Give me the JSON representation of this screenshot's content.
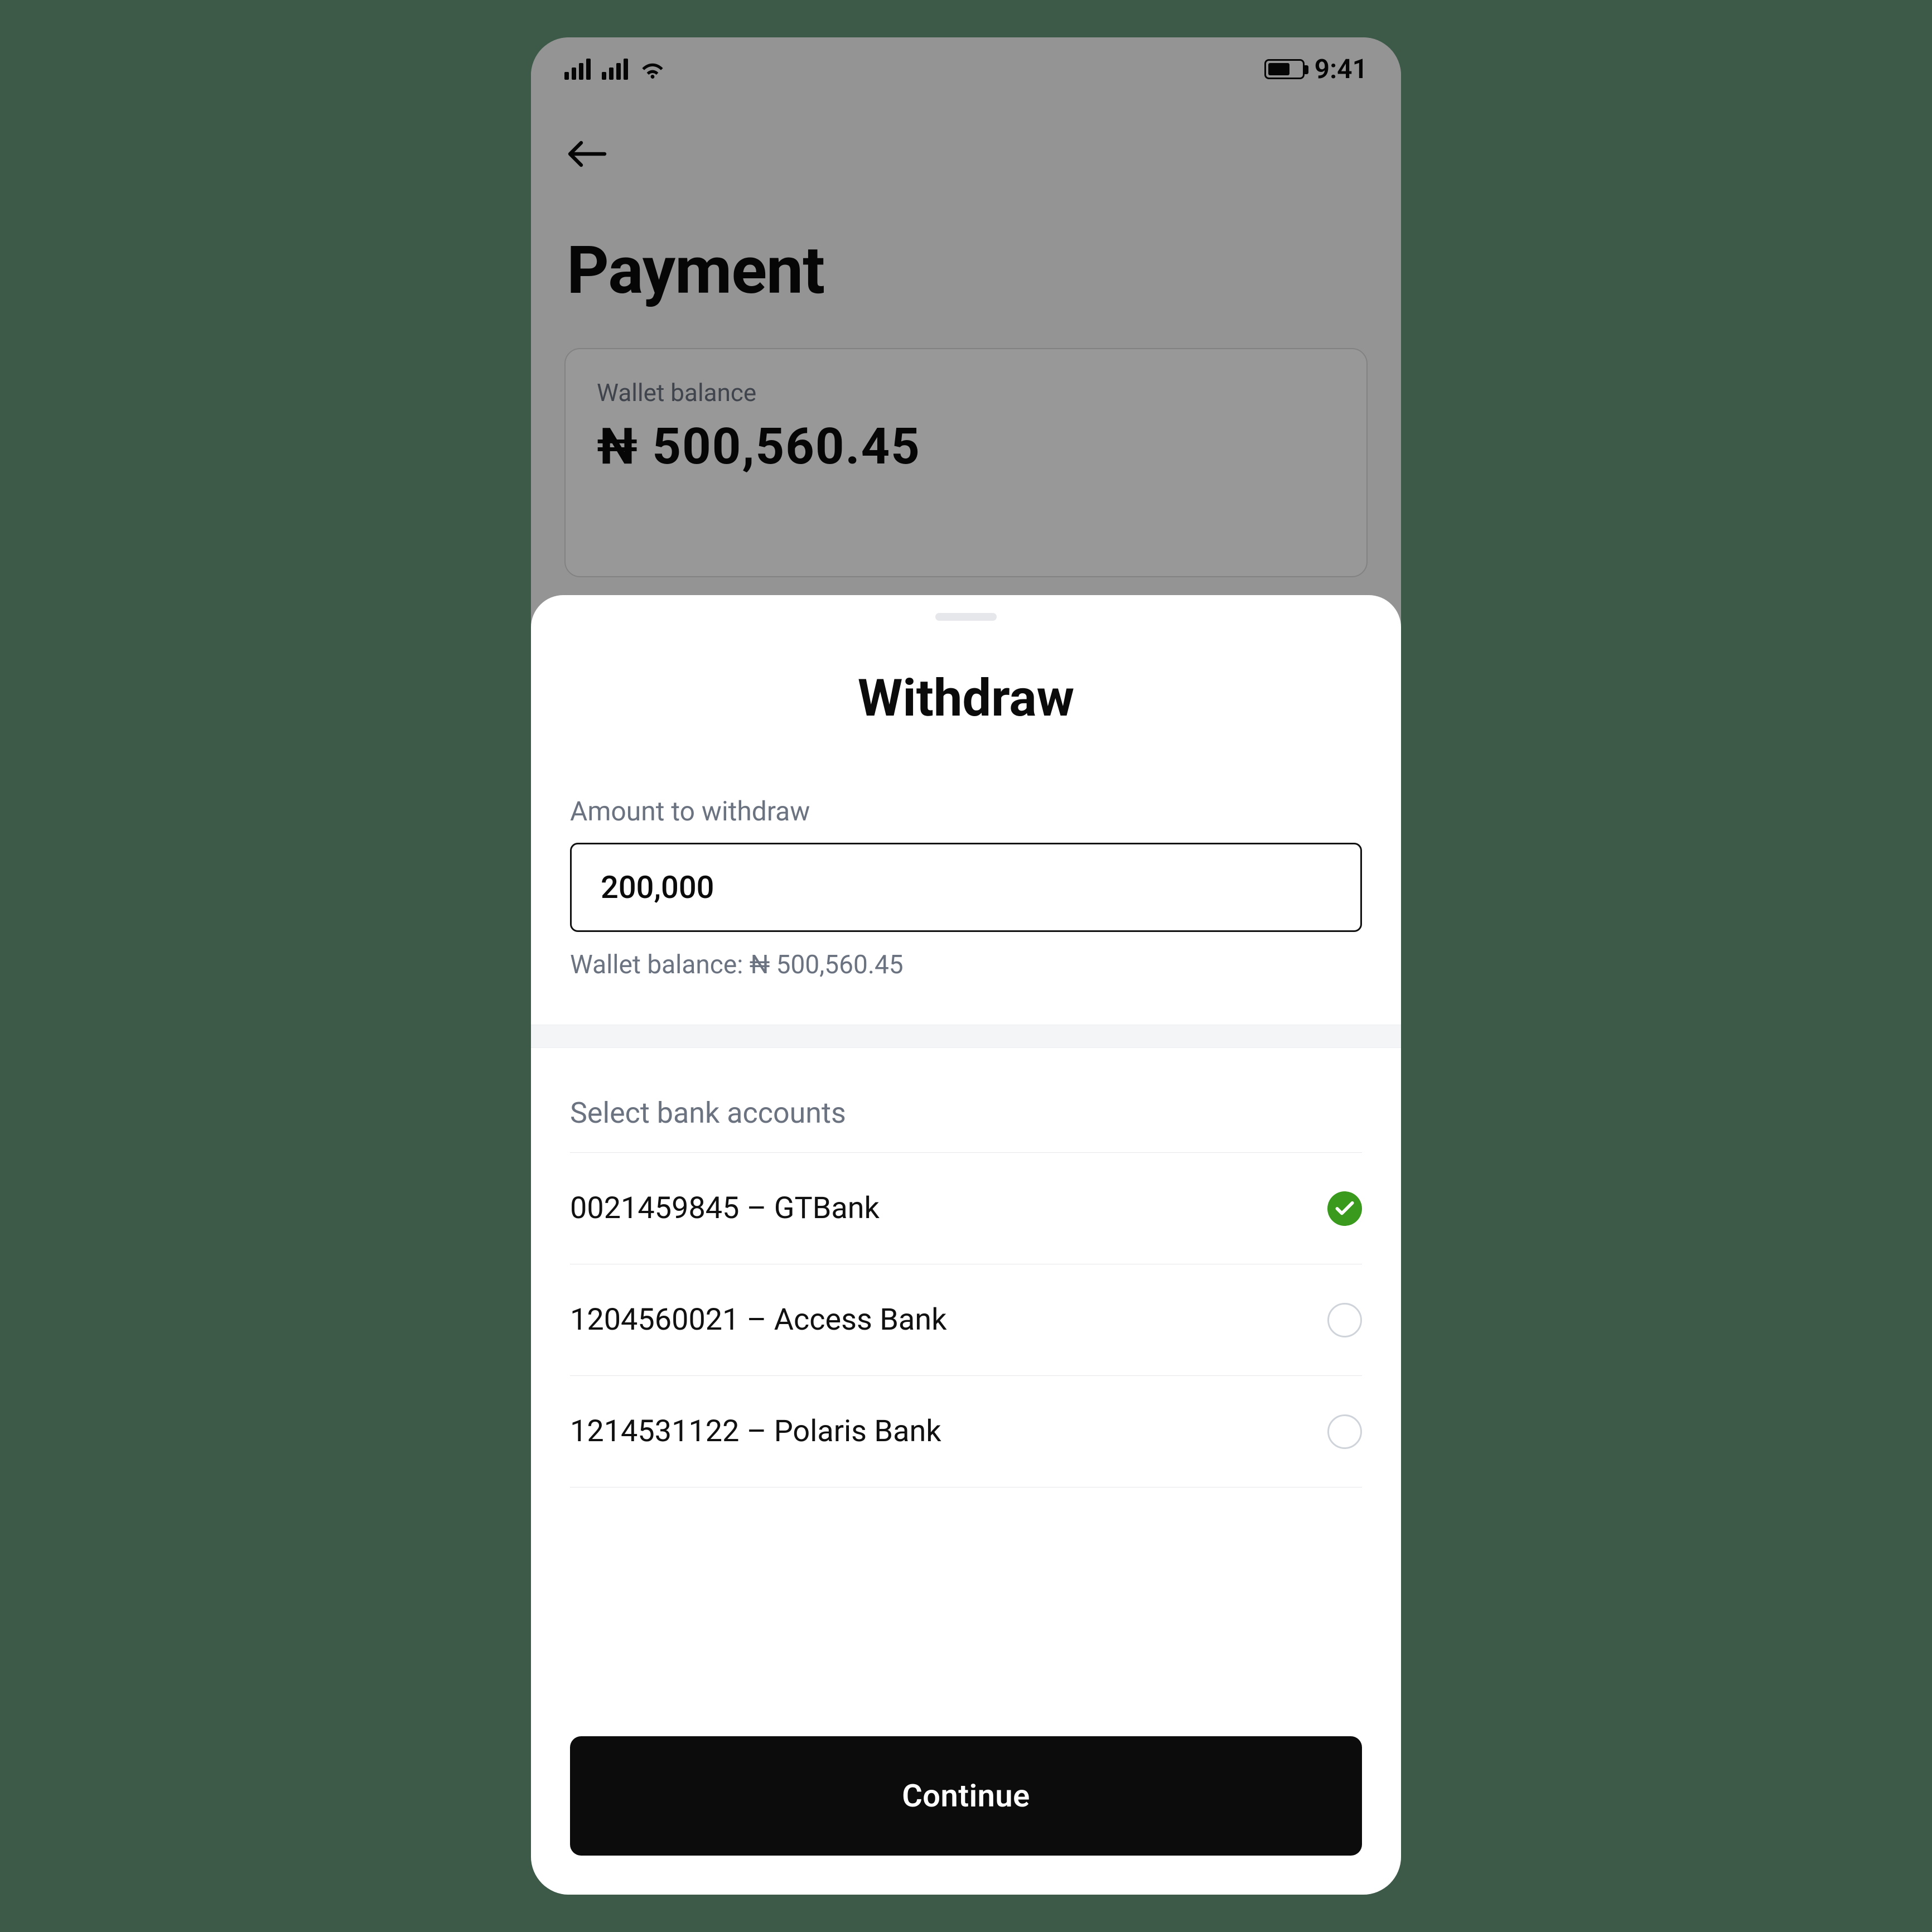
{
  "status_bar": {
    "time": "9:41"
  },
  "page": {
    "title": "Payment",
    "balance_label": "Wallet balance",
    "balance_value": "₦ 500,560.45"
  },
  "sheet": {
    "title": "Withdraw",
    "amount_label": "Amount to withdraw",
    "amount_value": "200,000",
    "helper_prefix": "Wallet balance: ",
    "helper_value": "₦ 500,560.45",
    "accounts_label": "Select bank accounts",
    "accounts": [
      {
        "label": "0021459845 – GTBank",
        "selected": true
      },
      {
        "label": "1204560021 – Access Bank",
        "selected": false
      },
      {
        "label": "1214531122 – Polaris Bank",
        "selected": false
      }
    ],
    "continue_label": "Continue"
  },
  "colors": {
    "accent": "#3a9a1d",
    "background_outer": "#3d5a48"
  }
}
